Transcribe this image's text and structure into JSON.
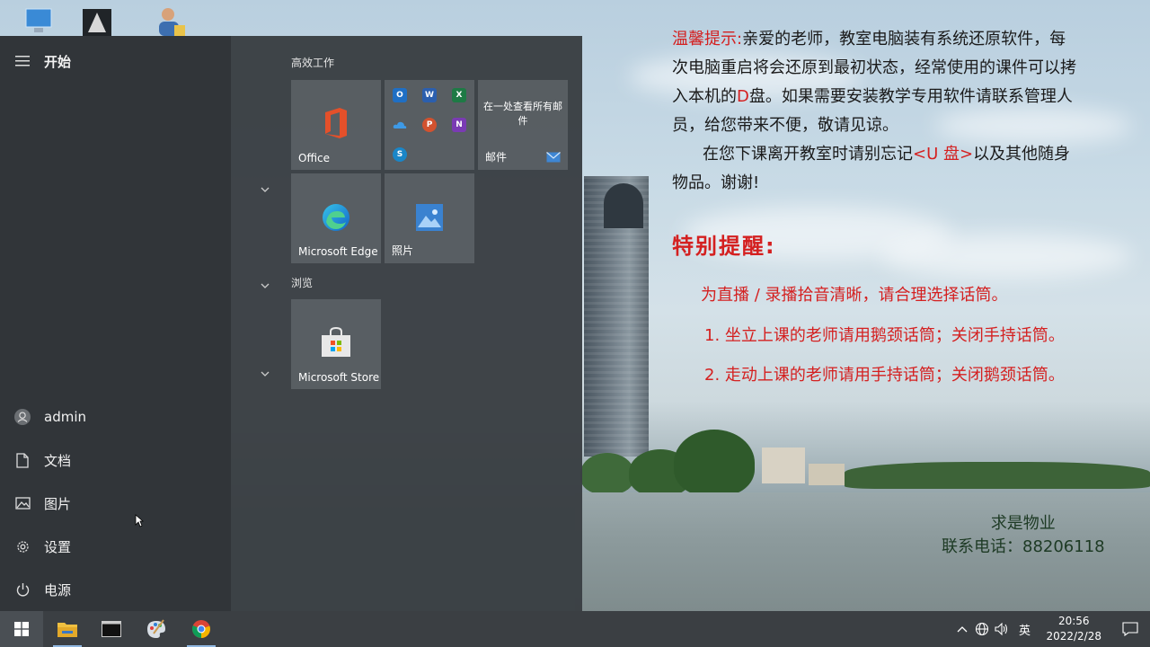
{
  "start_menu": {
    "title": "开始",
    "user": "admin",
    "left_items": [
      {
        "label": "文档",
        "icon": "document-icon"
      },
      {
        "label": "图片",
        "icon": "picture-icon"
      },
      {
        "label": "设置",
        "icon": "gear-icon"
      },
      {
        "label": "电源",
        "icon": "power-icon"
      }
    ],
    "groups": [
      {
        "label": "高效工作"
      },
      {
        "label": "浏览"
      }
    ],
    "tiles": {
      "office": "Office",
      "mail_text": "在一处查看所有邮件",
      "mail_label": "邮件",
      "edge": "Microsoft Edge",
      "photos": "照片",
      "store": "Microsoft Store"
    }
  },
  "notice": {
    "line1_red": "温馨提示:",
    "line1": "亲爱的老师，教室电脑装有系统还原软件，每",
    "line2": "次电脑重启将会还原到最初状态，经常使用的课件可以拷",
    "line3_a": "入本机的",
    "line3_red": "D",
    "line3_b": "盘。如果需要安装教学专用软件请联系管理人",
    "line4": "员，给您带来不便，敬请见谅。",
    "line5_a": "在您下课离开教室时请别忘记",
    "line5_red": "<U 盘>",
    "line5_b": "以及其他随身",
    "line6": "物品。谢谢!",
    "special_title": "特别提醒:",
    "special_1": "为直播 / 录播拾音清晰，请合理选择话筒。",
    "special_2": "1. 坐立上课的老师请用鹅颈话筒；关闭手持话筒。",
    "special_3": "2. 走动上课的老师请用手持话筒；关闭鹅颈话筒。",
    "footer_1": "求是物业",
    "footer_2": "联系电话：88206118"
  },
  "taskbar": {
    "language": "英",
    "time": "20:56",
    "date": "2022/2/28"
  },
  "colors": {
    "taskbar": "#3b3f43",
    "start_menu": "#3a3f43",
    "accent": "#8fb6e0",
    "notice_red": "#d42020"
  }
}
